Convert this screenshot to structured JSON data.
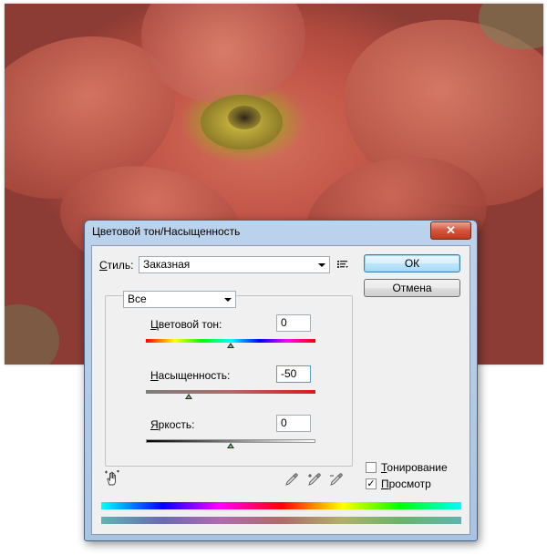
{
  "dialog": {
    "title": "Цветовой тон/Насыщенность",
    "close_glyph": "✕"
  },
  "style": {
    "label_prefix": "",
    "label_mnemonic": "С",
    "label_rest": "тиль:",
    "value": "Заказная"
  },
  "buttons": {
    "ok_label": "ОК",
    "cancel_label": "Отмена"
  },
  "channel": {
    "value": "Все"
  },
  "hue": {
    "label_mnemonic": "Ц",
    "label_rest": "ветовой тон:",
    "value": "0",
    "position": 0.5
  },
  "saturation": {
    "label_mnemonic": "Н",
    "label_rest": "асыщенность:",
    "value": "-50",
    "position": 0.25
  },
  "lightness": {
    "label_mnemonic": "Я",
    "label_rest": "ркость:",
    "value": "0",
    "position": 0.5
  },
  "colorize": {
    "label_mnemonic": "Т",
    "label_rest": "онирование",
    "checked": false
  },
  "preview": {
    "label_mnemonic": "П",
    "label_rest": "росмотр",
    "checked": true,
    "check_glyph": "✓"
  },
  "icons": {
    "menu": "preset-menu-icon",
    "hand": "targeted-adjustment-icon",
    "eyedropper": "eyedropper-icon",
    "eyedropper_plus": "eyedropper-plus-icon",
    "eyedropper_minus": "eyedropper-minus-icon"
  },
  "colors": {
    "dialog_frame": "#a9c3e3",
    "close_button": "#c0391f",
    "default_button_border": "#3c7fb1"
  }
}
